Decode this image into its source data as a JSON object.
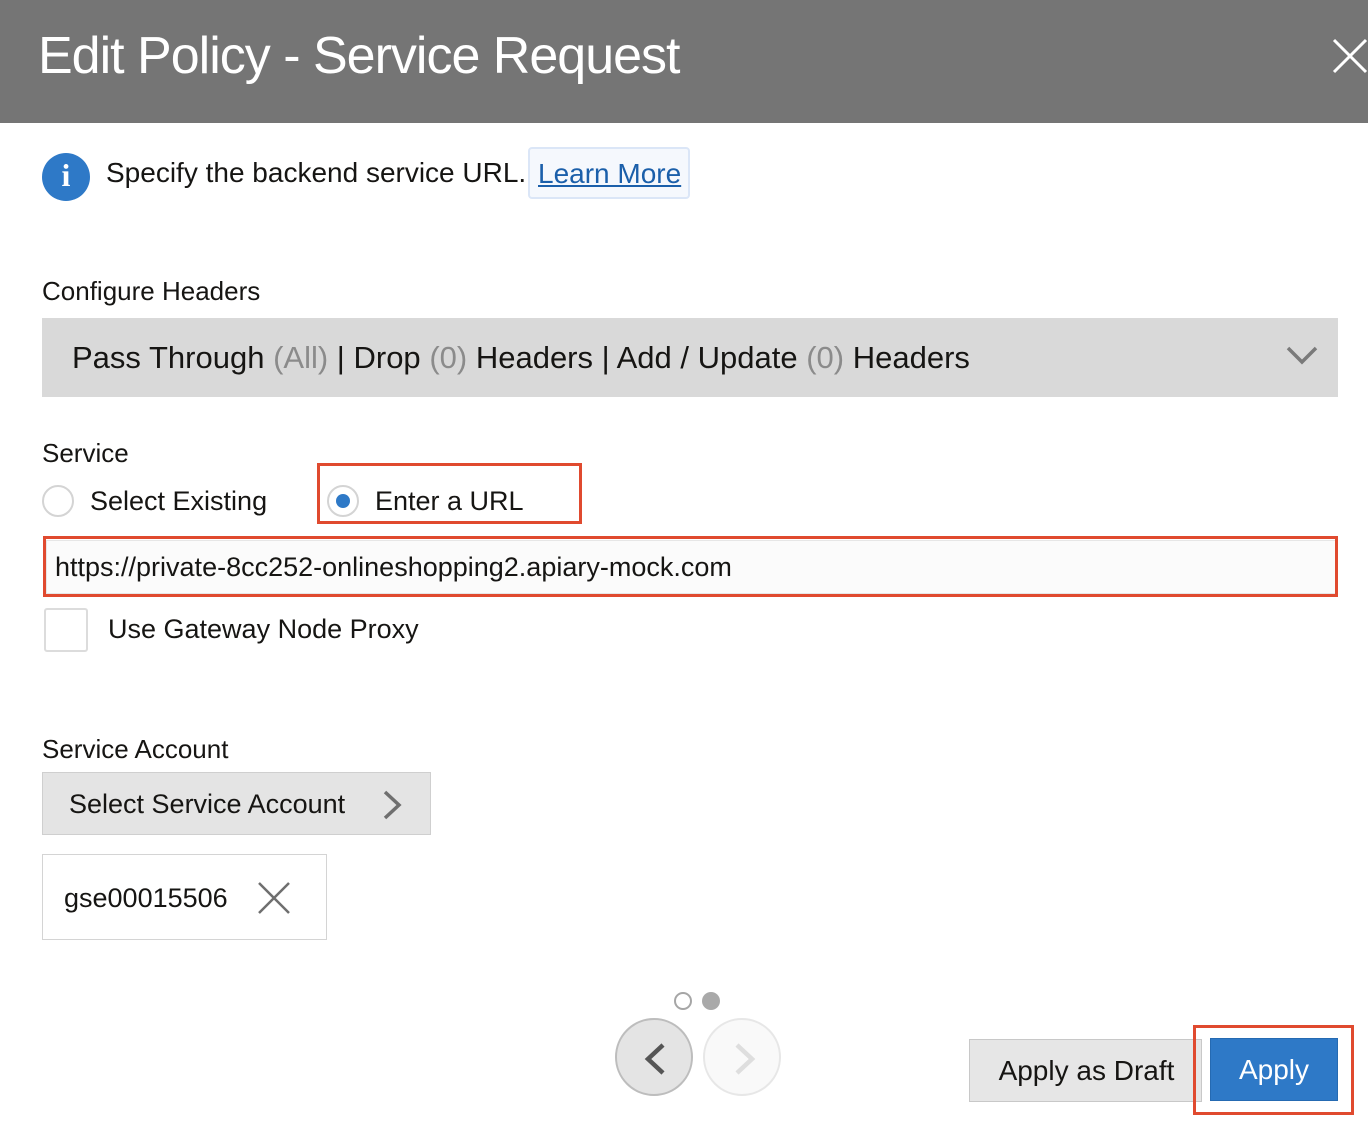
{
  "dialog": {
    "title": "Edit Policy - Service Request",
    "close_icon": "close-icon"
  },
  "info": {
    "icon": "info-icon",
    "icon_glyph": "i",
    "text": "Specify the backend service URL.",
    "link": "Learn More"
  },
  "headers": {
    "label": "Configure Headers",
    "pass_through": "Pass Through",
    "pass_through_count": "(All)",
    "sep1": "|",
    "drop": "Drop",
    "drop_count": "(0)",
    "drop_suffix": "Headers",
    "sep2": "|",
    "add_update": "Add / Update",
    "add_update_count": "(0)",
    "add_update_suffix": "Headers",
    "expand_icon": "chevron-down-icon"
  },
  "service": {
    "label": "Service",
    "options": [
      {
        "label": "Select Existing",
        "checked": false
      },
      {
        "label": "Enter a URL",
        "checked": true
      }
    ],
    "url_value": "https://private-8cc252-onlineshopping2.apiary-mock.com",
    "proxy_label": "Use Gateway Node Proxy",
    "proxy_checked": false
  },
  "service_account": {
    "label": "Service Account",
    "select_button": "Select Service Account",
    "select_icon": "chevron-right-icon",
    "selected": "gse00015506",
    "remove_icon": "remove-icon"
  },
  "pager": {
    "page_count": 2,
    "prev_icon": "chevron-left-icon",
    "next_icon": "chevron-right-icon"
  },
  "footer": {
    "apply_draft": "Apply as Draft",
    "apply": "Apply"
  },
  "colors": {
    "titlebar": "#757575",
    "primary": "#2e79c7",
    "highlight": "#e04a2f",
    "link": "#1b5faa"
  }
}
